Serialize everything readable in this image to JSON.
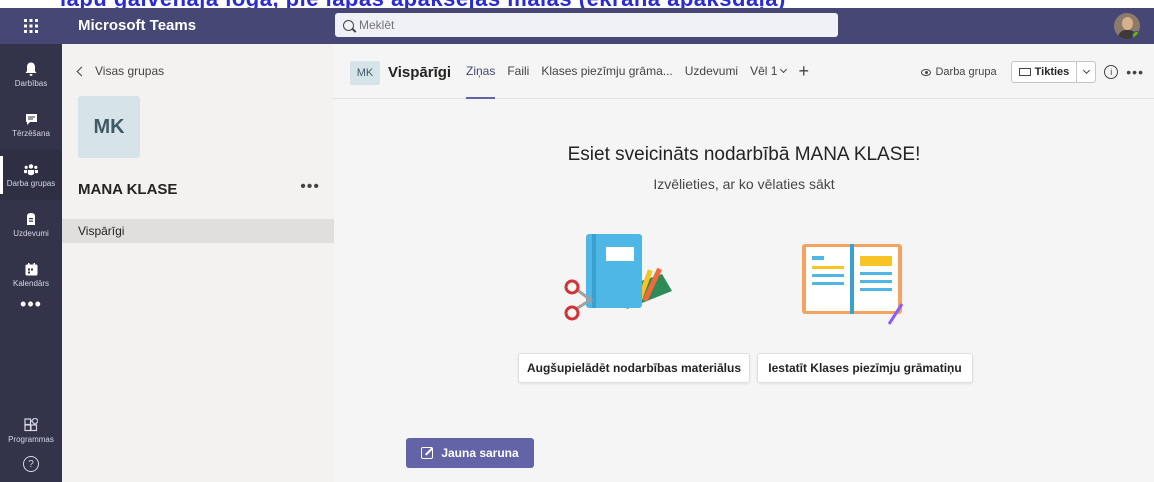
{
  "overlay_text": "lapu galvenajā logā, pie lapas apakšējās malas (ekrāna apakšdaļa)",
  "titlebar": {
    "app_name": "Microsoft Teams",
    "search_placeholder": "Meklēt",
    "colors": {
      "bar": "#464775",
      "rail": "#33344a",
      "accent": "#6264a7"
    }
  },
  "rail": {
    "items": [
      {
        "label": "Darbības",
        "icon": "bell-icon"
      },
      {
        "label": "Tērzēšana",
        "icon": "chat-icon"
      },
      {
        "label": "Darba grupas",
        "icon": "teams-icon"
      },
      {
        "label": "Uzdevumi",
        "icon": "assignments-icon"
      },
      {
        "label": "Kalendārs",
        "icon": "calendar-icon"
      }
    ],
    "more": "•••",
    "apps_label": "Programmas",
    "help_glyph": "?"
  },
  "sidebar": {
    "back_label": "Visas grupas",
    "team_initials": "MK",
    "team_name": "MANA KLASE",
    "team_more": "•••",
    "channels": [
      "Vispārīgi"
    ]
  },
  "channel": {
    "initials": "MK",
    "title": "Vispārīgi",
    "tabs": [
      "Ziņas",
      "Faili",
      "Klases piezīmju grāma...",
      "Uzdevumi",
      "Vēl 1"
    ],
    "active_tab": "Ziņas",
    "add_tab": "+",
    "team_button": "Darba grupa",
    "meet_button": "Tikties",
    "info_glyph": "i",
    "more_glyph": "•••"
  },
  "welcome": {
    "title": "Esiet sveicināts nodarbībā MANA KLASE!",
    "subtitle": "Izvēlieties, ar ko vēlaties sākt",
    "actions": [
      "Augšupielādēt nodarbības materiālus",
      "Iestatīt Klases piezīmju grāmatiņu"
    ]
  },
  "compose": {
    "new_conversation": "Jauna saruna"
  }
}
